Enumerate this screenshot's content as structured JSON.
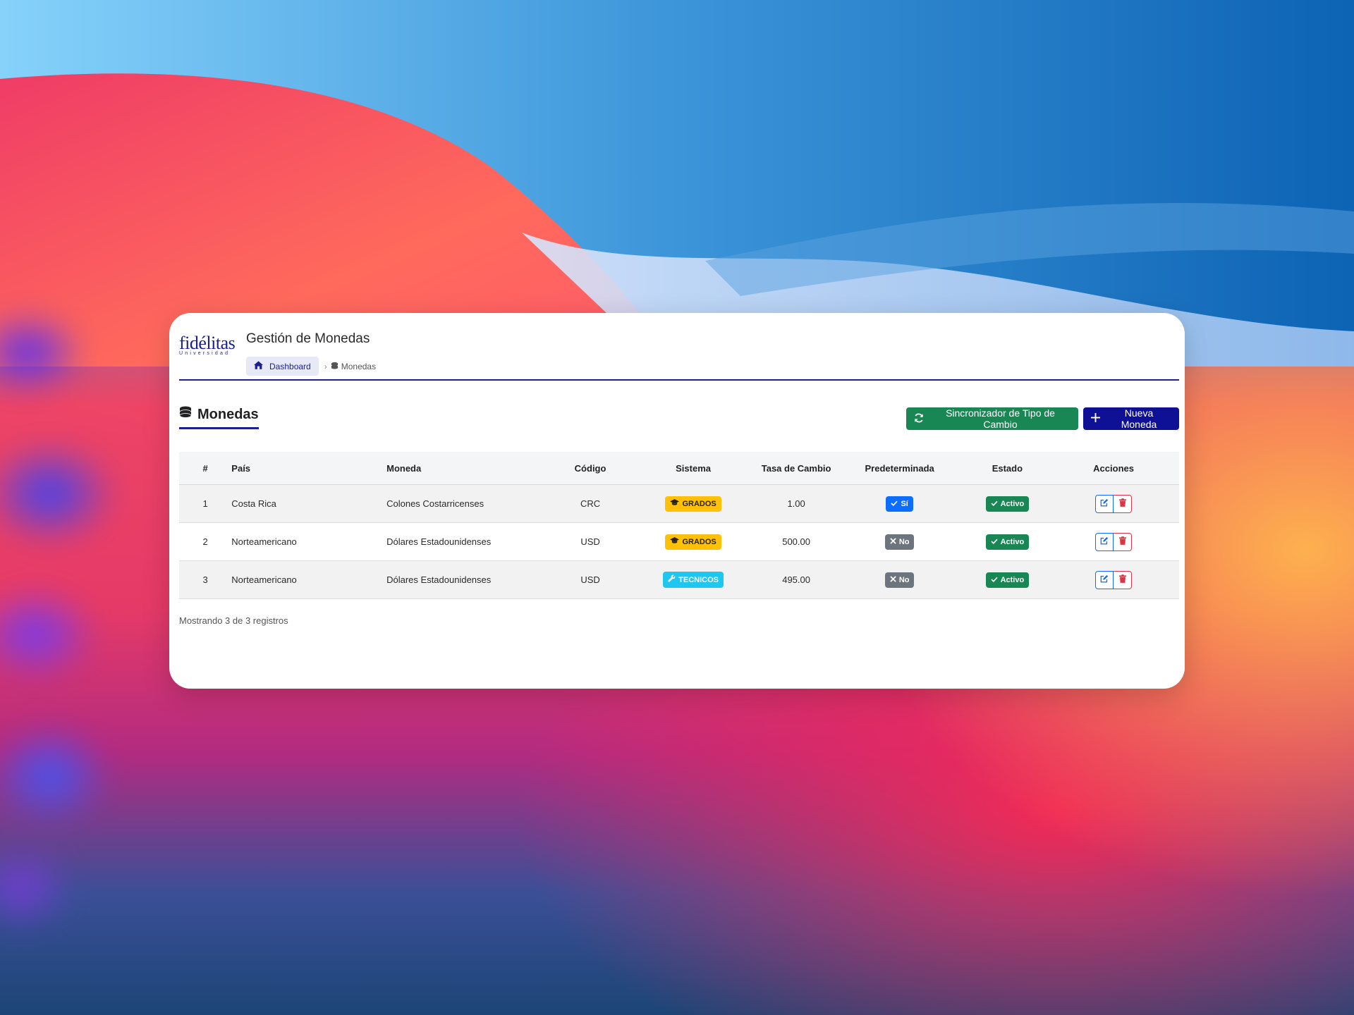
{
  "header": {
    "logo_text": "fidélitas",
    "logo_subtext": "Universidad",
    "title": "Gestión de Monedas",
    "breadcrumb": {
      "home_label": "Dashboard",
      "current_label": "Monedas"
    }
  },
  "section": {
    "title": "Monedas",
    "sync_button_label": "Sincronizador de Tipo de Cambio",
    "new_button_label": "Nueva Moneda"
  },
  "table": {
    "columns": [
      "#",
      "País",
      "Moneda",
      "Código",
      "Sistema",
      "Tasa de Cambio",
      "Predeterminada",
      "Estado",
      "Acciones"
    ],
    "rows": [
      {
        "num": "1",
        "pais": "Costa Rica",
        "moneda": "Colones Costarricenses",
        "codigo": "CRC",
        "sistema": "GRADOS",
        "sistema_icon": "graduation-cap-icon",
        "tasa": "1.00",
        "predeterminada": "Sí",
        "estado": "Activo"
      },
      {
        "num": "2",
        "pais": "Norteamericano",
        "moneda": "Dólares Estadounidenses",
        "codigo": "USD",
        "sistema": "GRADOS",
        "sistema_icon": "graduation-cap-icon",
        "tasa": "500.00",
        "predeterminada": "No",
        "estado": "Activo"
      },
      {
        "num": "3",
        "pais": "Norteamericano",
        "moneda": "Dólares Estadounidenses",
        "codigo": "USD",
        "sistema": "TECNICOS",
        "sistema_icon": "wrench-icon",
        "tasa": "495.00",
        "predeterminada": "No",
        "estado": "Activo"
      }
    ]
  },
  "footer": {
    "records_info": "Mostrando 3 de 3 registros"
  },
  "colors": {
    "brand_navy": "#1b1f8f",
    "success": "#198754",
    "primary": "#0d6efd",
    "warning": "#ffc107",
    "info": "#1fc7ee",
    "secondary": "#6c757d",
    "danger": "#dc3545"
  }
}
